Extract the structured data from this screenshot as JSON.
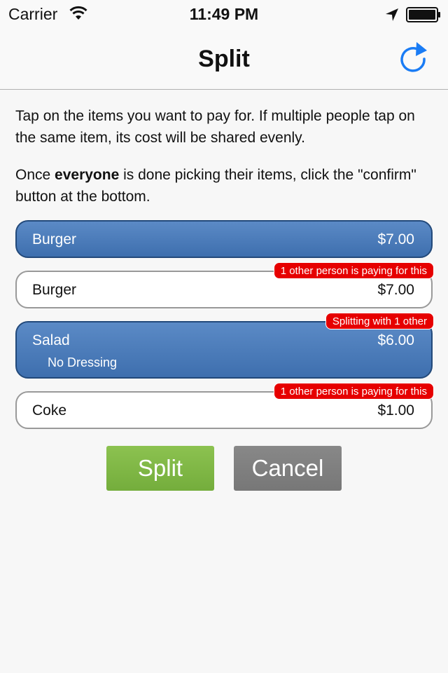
{
  "status_bar": {
    "carrier": "Carrier",
    "time": "11:49 PM",
    "wifi_icon": "wifi-icon",
    "location_icon": "location-arrow-icon",
    "battery_icon": "battery-icon"
  },
  "nav": {
    "title": "Split",
    "refresh_icon": "refresh-icon",
    "accent_color": "#1a7cf5"
  },
  "instructions": {
    "line1": "Tap on the items you want to pay for. If multiple people tap on the same item, its cost will be shared evenly.",
    "line2_before": "Once ",
    "line2_bold": "everyone",
    "line2_after": " is done picking their items, click the \"confirm\" button at the bottom."
  },
  "items": [
    {
      "name": "Burger",
      "price": "$7.00",
      "selected": true
    },
    {
      "name": "Burger",
      "price": "$7.00",
      "selected": false,
      "badge": "1 other person is paying for this"
    },
    {
      "name": "Salad",
      "price": "$6.00",
      "note": "No Dressing",
      "selected": true,
      "badge": "Splitting with 1 other"
    },
    {
      "name": "Coke",
      "price": "$1.00",
      "selected": false,
      "badge": "1 other person is paying for this"
    }
  ],
  "buttons": {
    "split_label": "Split",
    "cancel_label": "Cancel"
  },
  "colors": {
    "selected_item": "#4a7bb9",
    "badge": "#e60000",
    "split_button": "#80b846",
    "cancel_button": "#808080"
  }
}
